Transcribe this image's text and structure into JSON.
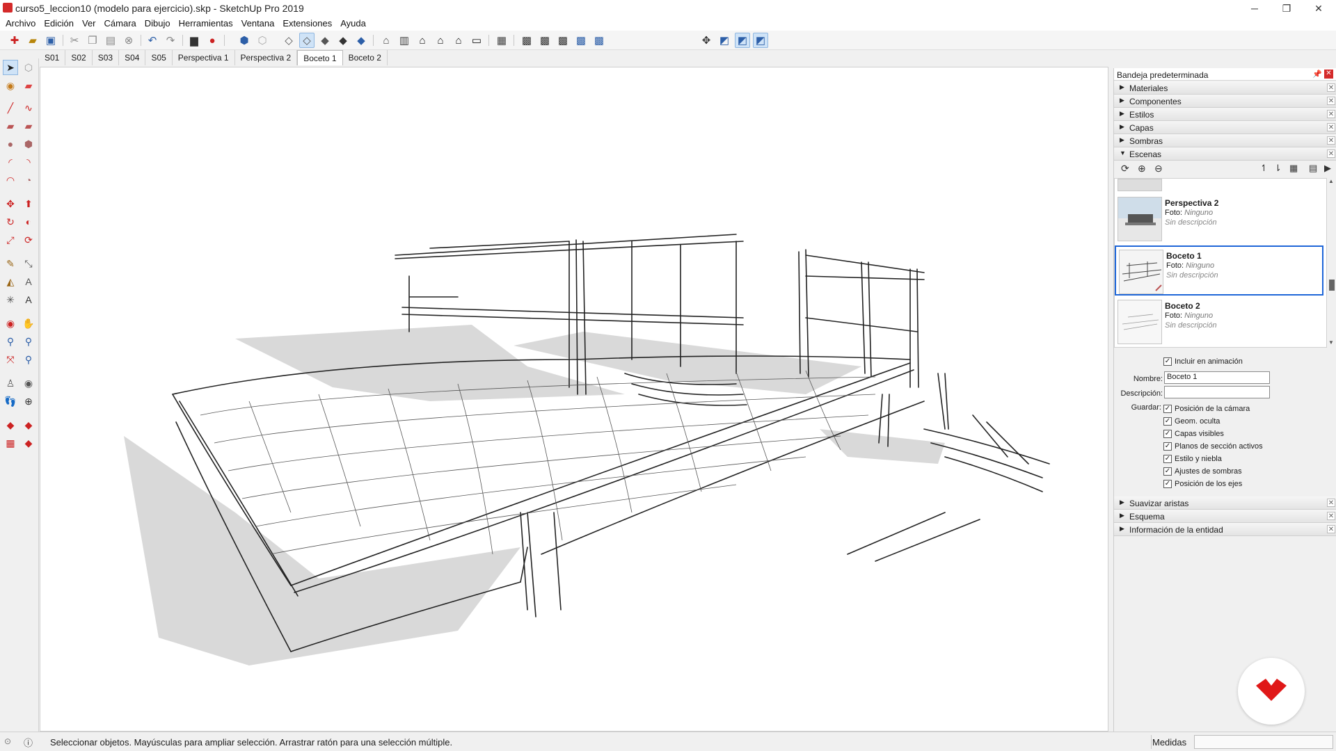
{
  "window": {
    "title": "curso5_leccion10 (modelo para ejercicio).skp - SketchUp Pro 2019",
    "controls": {
      "minimize": "─",
      "restore": "❐",
      "close": "✕"
    }
  },
  "menu": [
    "Archivo",
    "Edición",
    "Ver",
    "Cámara",
    "Dibujo",
    "Herramientas",
    "Ventana",
    "Extensiones",
    "Ayuda"
  ],
  "scene_tabs": [
    "S01",
    "S02",
    "S03",
    "S04",
    "S05",
    "Perspectiva 1",
    "Perspectiva 2",
    "Boceto 1",
    "Boceto 2"
  ],
  "active_scene_tab": "Boceto 1",
  "tray": {
    "title": "Bandeja predeterminada",
    "panels_top": [
      "Materiales",
      "Componentes",
      "Estilos",
      "Capas",
      "Sombras"
    ],
    "expanded_panel": "Escenas",
    "panels_bottom": [
      "Suavizar aristas",
      "Esquema",
      "Información de la entidad"
    ],
    "scenes": [
      {
        "name": "Perspectiva 2",
        "foto_label": "Foto:",
        "foto_value": "Ninguno",
        "desc": "Sin descripción"
      },
      {
        "name": "Boceto 1",
        "foto_label": "Foto:",
        "foto_value": "Ninguno",
        "desc": "Sin descripción"
      },
      {
        "name": "Boceto 2",
        "foto_label": "Foto:",
        "foto_value": "Ninguno",
        "desc": "Sin descripción"
      }
    ],
    "include_animation": "Incluir en animación",
    "name_label": "Nombre:",
    "name_value": "Boceto 1",
    "desc_label": "Descripción:",
    "desc_value": "",
    "save_label": "Guardar:",
    "save_options": [
      "Posición de la cámara",
      "Geom. oculta",
      "Capas visibles",
      "Planos de sección activos",
      "Estilo y niebla",
      "Ajustes de sombras",
      "Posición de los ejes"
    ]
  },
  "status": {
    "message": "Seleccionar objetos. Mayúsculas para ampliar selección. Arrastrar ratón para una selección múltiple.",
    "measure_label": "Medidas"
  },
  "colors": {
    "accent": "#1e66d8",
    "brand_red": "#d42a2a"
  }
}
